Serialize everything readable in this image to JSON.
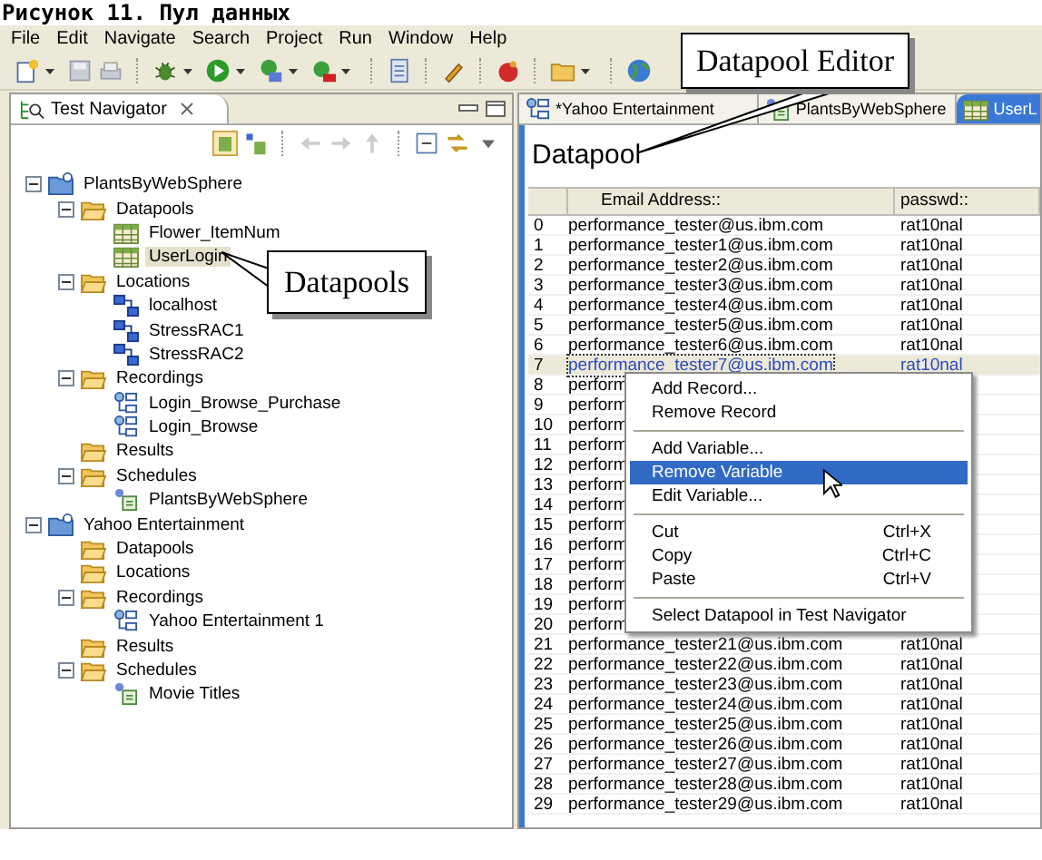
{
  "caption": "Рисунок 11. Пул данных",
  "menu": [
    "File",
    "Edit",
    "Navigate",
    "Search",
    "Project",
    "Run",
    "Window",
    "Help"
  ],
  "navigator": {
    "title": "Test Navigator",
    "tree": [
      {
        "kind": "project",
        "label": "PlantsByWebSphere",
        "expanded": true,
        "selected": false,
        "children": [
          {
            "kind": "folder",
            "label": "Datapools",
            "expanded": true,
            "selected": false,
            "children": [
              {
                "kind": "datapool",
                "label": "Flower_ItemNum",
                "selected": false
              },
              {
                "kind": "datapool",
                "label": "UserLogin",
                "selected": true
              }
            ]
          },
          {
            "kind": "folder",
            "label": "Locations",
            "expanded": true,
            "selected": false,
            "children": [
              {
                "kind": "location",
                "label": "localhost",
                "selected": false
              },
              {
                "kind": "location",
                "label": "StressRAC1",
                "selected": false
              },
              {
                "kind": "location",
                "label": "StressRAC2",
                "selected": false
              }
            ]
          },
          {
            "kind": "folder",
            "label": "Recordings",
            "expanded": true,
            "selected": false,
            "children": [
              {
                "kind": "recording",
                "label": "Login_Browse_Purchase",
                "selected": false
              },
              {
                "kind": "recording",
                "label": "Login_Browse",
                "selected": false
              }
            ]
          },
          {
            "kind": "folder",
            "label": "Results",
            "selected": false
          },
          {
            "kind": "folder",
            "label": "Schedules",
            "expanded": true,
            "selected": false,
            "children": [
              {
                "kind": "schedule",
                "label": "PlantsByWebSphere",
                "selected": false
              }
            ]
          }
        ]
      },
      {
        "kind": "project",
        "label": "Yahoo Entertainment",
        "expanded": true,
        "selected": false,
        "children": [
          {
            "kind": "folder",
            "label": "Datapools",
            "selected": false
          },
          {
            "kind": "folder",
            "label": "Locations",
            "selected": false
          },
          {
            "kind": "folder",
            "label": "Recordings",
            "expanded": true,
            "selected": false,
            "children": [
              {
                "kind": "recording",
                "label": "Yahoo Entertainment 1",
                "selected": false
              }
            ]
          },
          {
            "kind": "folder",
            "label": "Results",
            "selected": false
          },
          {
            "kind": "folder",
            "label": "Schedules",
            "expanded": true,
            "selected": false,
            "children": [
              {
                "kind": "schedule",
                "label": "Movie Titles",
                "selected": false
              }
            ]
          }
        ]
      }
    ]
  },
  "editor_tabs": [
    {
      "kind": "recording",
      "label": "*Yahoo Entertainment",
      "selected": false
    },
    {
      "kind": "schedule",
      "label": "PlantsByWebSphere",
      "selected": false
    },
    {
      "kind": "datapool",
      "label": "UserL",
      "selected": true
    }
  ],
  "datapool": {
    "heading": "Datapool",
    "columns": [
      "Email Address::",
      "passwd::"
    ],
    "rows": [
      {
        "index": "0",
        "email": "performance_tester@us.ibm.com",
        "passwd": "rat10nal",
        "selected": false
      },
      {
        "index": "1",
        "email": "performance_tester1@us.ibm.com",
        "passwd": "rat10nal",
        "selected": false
      },
      {
        "index": "2",
        "email": "performance_tester2@us.ibm.com",
        "passwd": "rat10nal",
        "selected": false
      },
      {
        "index": "3",
        "email": "performance_tester3@us.ibm.com",
        "passwd": "rat10nal",
        "selected": false
      },
      {
        "index": "4",
        "email": "performance_tester4@us.ibm.com",
        "passwd": "rat10nal",
        "selected": false
      },
      {
        "index": "5",
        "email": "performance_tester5@us.ibm.com",
        "passwd": "rat10nal",
        "selected": false
      },
      {
        "index": "6",
        "email": "performance_tester6@us.ibm.com",
        "passwd": "rat10nal",
        "selected": false
      },
      {
        "index": "7",
        "email": "performance_tester7@us.ibm.com",
        "passwd": "rat10nal",
        "selected": true
      },
      {
        "index": "8",
        "email": "perform",
        "selected": false
      },
      {
        "index": "9",
        "email": "perform",
        "selected": false
      },
      {
        "index": "10",
        "email": "perform",
        "selected": false
      },
      {
        "index": "11",
        "email": "perform",
        "selected": false
      },
      {
        "index": "12",
        "email": "perform",
        "selected": false
      },
      {
        "index": "13",
        "email": "perform",
        "selected": false
      },
      {
        "index": "14",
        "email": "perform",
        "selected": false
      },
      {
        "index": "15",
        "email": "perform",
        "selected": false
      },
      {
        "index": "16",
        "email": "perform",
        "selected": false
      },
      {
        "index": "17",
        "email": "perform",
        "selected": false
      },
      {
        "index": "18",
        "email": "perform",
        "selected": false
      },
      {
        "index": "19",
        "email": "perform",
        "selected": false
      },
      {
        "index": "20",
        "email": "perform",
        "selected": false
      },
      {
        "index": "21",
        "email": "performance_tester21@us.ibm.com",
        "passwd": "rat10nal",
        "selected": false
      },
      {
        "index": "22",
        "email": "performance_tester22@us.ibm.com",
        "passwd": "rat10nal",
        "selected": false
      },
      {
        "index": "23",
        "email": "performance_tester23@us.ibm.com",
        "passwd": "rat10nal",
        "selected": false
      },
      {
        "index": "24",
        "email": "performance_tester24@us.ibm.com",
        "passwd": "rat10nal",
        "selected": false
      },
      {
        "index": "25",
        "email": "performance_tester25@us.ibm.com",
        "passwd": "rat10nal",
        "selected": false
      },
      {
        "index": "26",
        "email": "performance_tester26@us.ibm.com",
        "passwd": "rat10nal",
        "selected": false
      },
      {
        "index": "27",
        "email": "performance_tester27@us.ibm.com",
        "passwd": "rat10nal",
        "selected": false
      },
      {
        "index": "28",
        "email": "performance_tester28@us.ibm.com",
        "passwd": "rat10nal",
        "selected": false
      },
      {
        "index": "29",
        "email": "performance_tester29@us.ibm.com",
        "passwd": "rat10nal",
        "selected": false
      }
    ]
  },
  "context_menu": [
    {
      "kind": "item",
      "label": "Add Record...",
      "selected": false
    },
    {
      "kind": "item",
      "label": "Remove Record",
      "selected": false
    },
    {
      "kind": "separator"
    },
    {
      "kind": "item",
      "label": "Add Variable...",
      "selected": false
    },
    {
      "kind": "item",
      "label": "Remove Variable",
      "selected": true
    },
    {
      "kind": "item",
      "label": "Edit Variable...",
      "selected": false
    },
    {
      "kind": "separator"
    },
    {
      "kind": "item",
      "label": "Cut",
      "shortcut": "Ctrl+X",
      "selected": false
    },
    {
      "kind": "item",
      "label": "Copy",
      "shortcut": "Ctrl+C",
      "selected": false
    },
    {
      "kind": "item",
      "label": "Paste",
      "shortcut": "Ctrl+V",
      "selected": false
    },
    {
      "kind": "separator"
    },
    {
      "kind": "item",
      "label": "Select Datapool in Test Navigator",
      "selected": false
    }
  ],
  "callouts": [
    "Datapool Editor",
    "Datapools"
  ]
}
